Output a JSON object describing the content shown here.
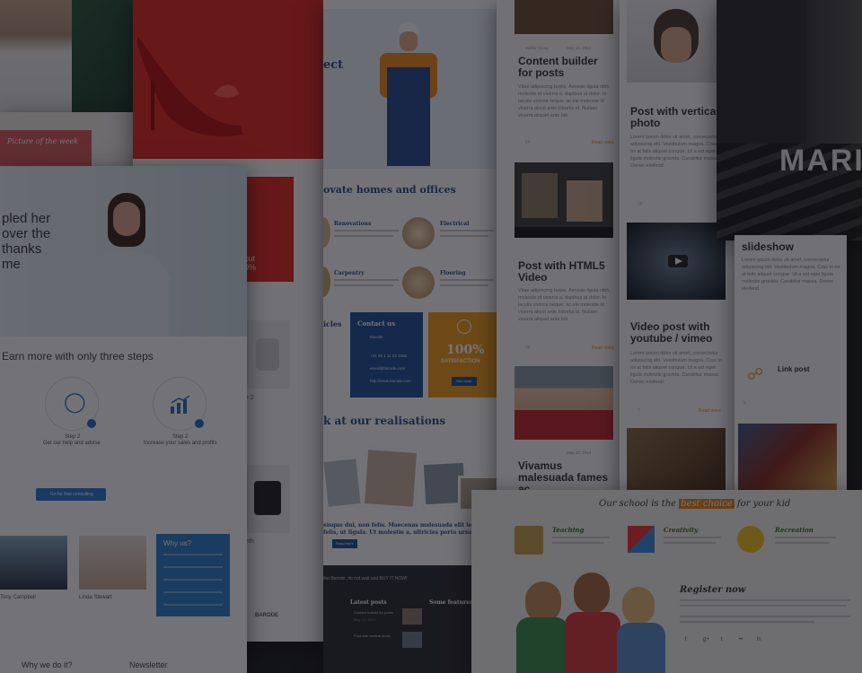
{
  "collage": {
    "card_consult": {
      "picture_label": "Picture of the week",
      "hero_text": [
        "pled her",
        "over the",
        "thanks",
        "me"
      ],
      "heading": "Earn more with only three steps",
      "steps": [
        {
          "title": "Step 2",
          "subtitle": "Get our help and advise"
        },
        {
          "title": "Step 2",
          "subtitle": "Increase your sales and profits"
        }
      ],
      "cta_label": "Go for free consulting",
      "team": [
        {
          "name": "Tony Campbell"
        },
        {
          "name": "Linda Stewart"
        }
      ],
      "why_title": "Why us?",
      "footer_left": "Why we do it?",
      "footer_right": "Newsletter"
    },
    "card_shop": {
      "discount_text": [
        "cut",
        "0%"
      ],
      "item_label": "e 2",
      "item_label_2": "eth",
      "logo": "BARODE"
    },
    "card_builder": {
      "title_fragment": "ect",
      "section_title": "ovate homes and offices",
      "services": [
        {
          "name": "Renovations",
          "icon": "paint-roller-icon"
        },
        {
          "name": "Electrical",
          "icon": "lightbulb-icon"
        },
        {
          "name": "Carpentry",
          "icon": "saw-icon"
        },
        {
          "name": "Flooring",
          "icon": "floor-icon"
        }
      ],
      "articles_label": "icles",
      "contact_title": "Contact us",
      "contact_lines": [
        "Barode",
        "+41 09 1 11 22 3456",
        "email@barode.com",
        "http://www.barode.com"
      ],
      "badge_value": "100%",
      "badge_text": "SATISFACTION",
      "badge_button": "See more",
      "realisations_title": "k at our realisations",
      "quote": "eisque dui, non felis. Maecenas malesuada elit lectus felis, ut ligula. Ut molestie a, ultricies porta urna.",
      "quote_button": "Read more",
      "bottom_banner": "the Barode, do not wait and BUY IT NOW!",
      "latest_posts_title": "Latest posts",
      "posts": [
        "Content builder for posts",
        "Post with vertical photo"
      ],
      "post_date": "May 13, 2014",
      "features_title": "Some features"
    },
    "card_blog": {
      "meta": "Muffin Group",
      "date": "May 13, 2014",
      "posts": [
        {
          "title": "Content builder for posts"
        },
        {
          "title": "Post with HTML5 Video"
        },
        {
          "title": "Vivamus malesuada fames ac"
        }
      ],
      "excerpt": "Vitae adipiscing turpis. Aenean ligula nibh, molestie id viverra a, dapibus at dolor. In iaculis viverra neque, ac ele molestie id viverra aliest ante lobortis id. Nullam viverra aliquet ante lob",
      "likes_1": "54",
      "likes_2": "76",
      "comments": "3",
      "read_more": "Read more"
    },
    "card_blog2": {
      "posts": [
        {
          "title": "Post with vertical photo"
        },
        {
          "title": "Video post with youtube / vimeo"
        },
        {
          "title": "Link post"
        }
      ],
      "excerpt": "Lorem ipsum dolor sit amet, consectetur adipiscing elit. Vestibulum magna. Cras in mi at felis aliquet congue. Ut a est eget ligula molestie gravida. Curabitur massa. Donec eleifend.",
      "likes": "26",
      "likes_2": "7",
      "likes_3": "5",
      "read_more": "Read more"
    },
    "card_school": {
      "heading_pre": "Our school is the",
      "heading_highlight": "best choice",
      "heading_post": "for your kid",
      "features": [
        {
          "title": "Teaching",
          "icon": "notebook-icon"
        },
        {
          "title": "Creativity",
          "icon": "puzzle-icon"
        },
        {
          "title": "Recreation",
          "icon": "duck-toy-icon"
        }
      ],
      "register_title": "Register now",
      "social": [
        "f",
        "g+",
        "t",
        "••",
        "in"
      ]
    },
    "card_portrait": {
      "name_fragment": "MARI",
      "slideshow_title": "slideshow"
    }
  },
  "colors": {
    "overlay": "#0e0e14",
    "accent_red": "#e3231d",
    "accent_blue": "#1d5faa",
    "accent_orange": "#f0a019",
    "title_blue": "#2c4b7a",
    "school_orange": "#e2861b"
  }
}
